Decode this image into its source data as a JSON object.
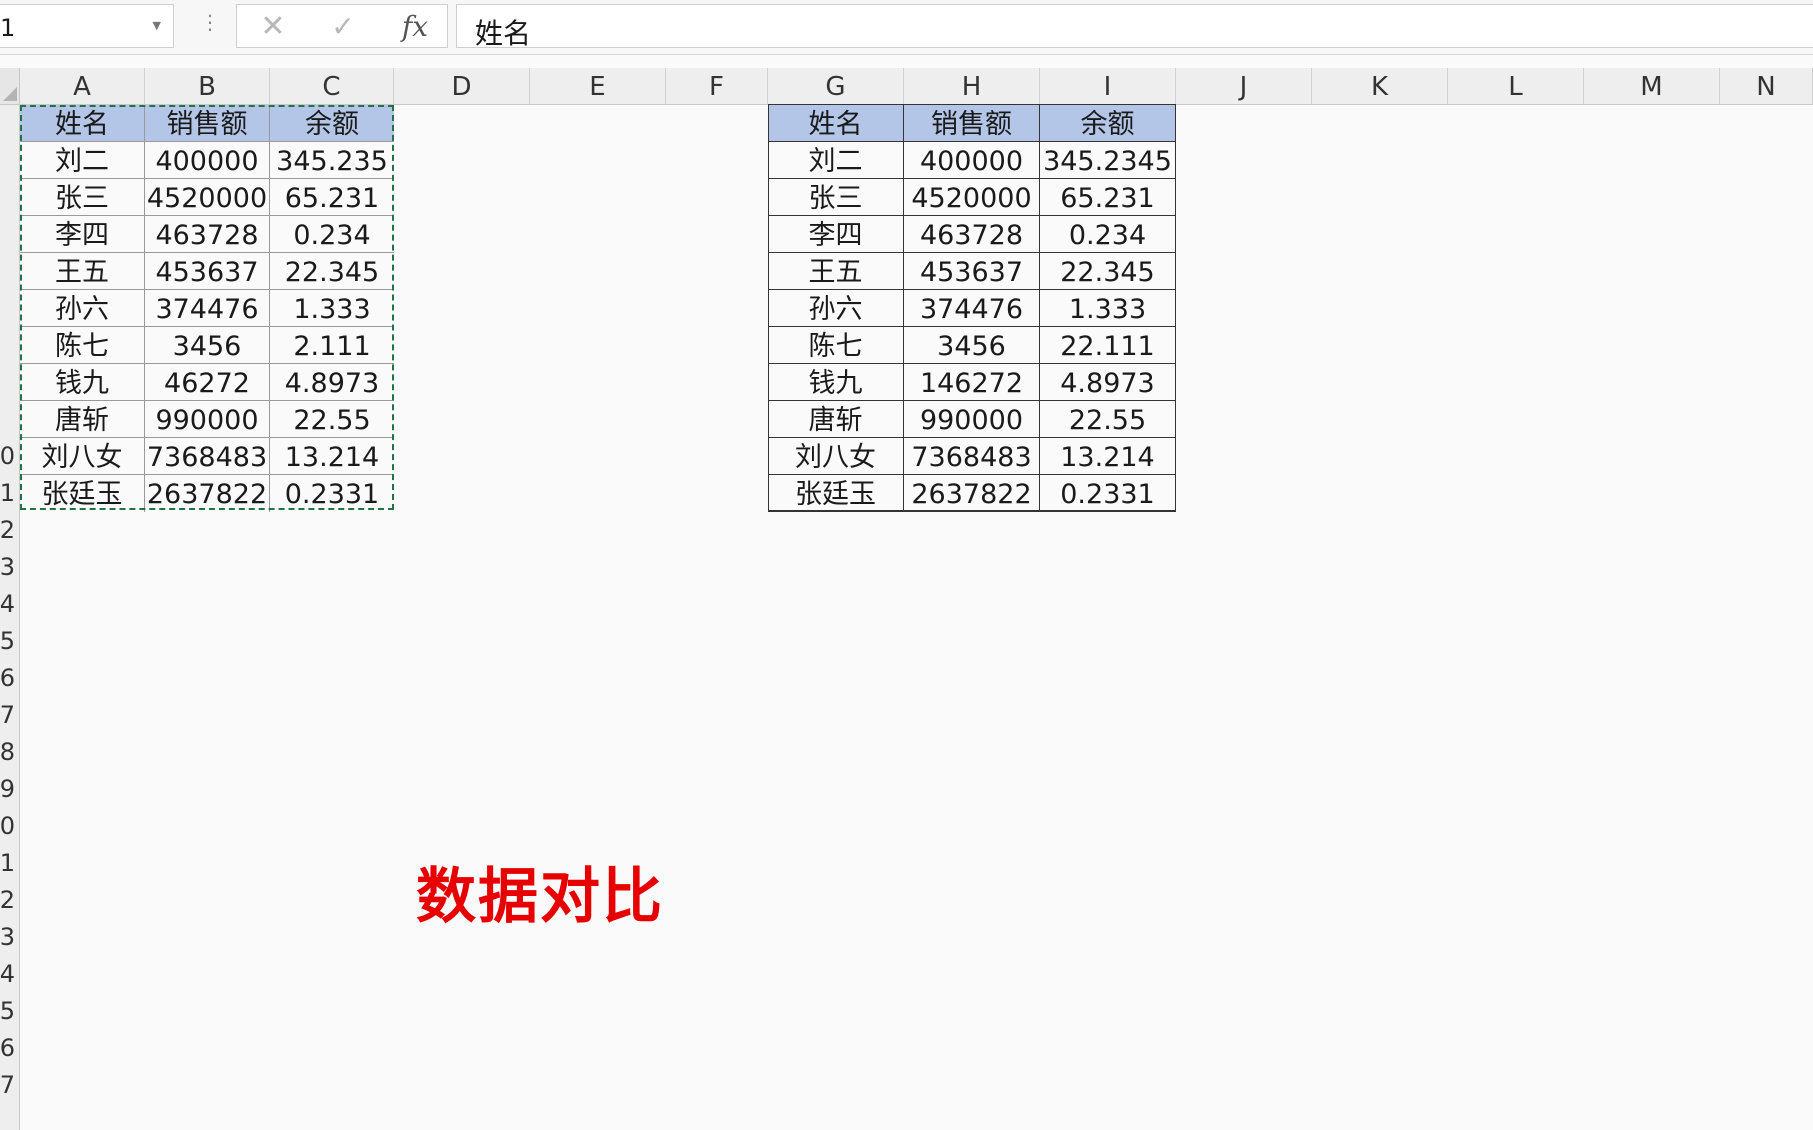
{
  "formula_bar": {
    "name_box_value": "1",
    "formula_value": "姓名",
    "icons": [
      "cancel-icon",
      "enter-icon",
      "fx-icon"
    ]
  },
  "grid": {
    "columns": [
      "A",
      "B",
      "C",
      "D",
      "E",
      "F",
      "G",
      "H",
      "I",
      "J",
      "K",
      "L",
      "M",
      "N"
    ],
    "row_labels": [
      "",
      "",
      "",
      "",
      "",
      "",
      "",
      "",
      "",
      "0",
      "1",
      "2",
      "3",
      "4",
      "5",
      "6",
      "7",
      "8",
      "9",
      "0",
      "1",
      "2",
      "3",
      "4",
      "5",
      "6",
      "7"
    ]
  },
  "table_left": {
    "headers": [
      "姓名",
      "销售额",
      "余额"
    ],
    "rows": [
      [
        "刘二",
        "400000",
        "345.235"
      ],
      [
        "张三",
        "4520000",
        "65.231"
      ],
      [
        "李四",
        "463728",
        "0.234"
      ],
      [
        "王五",
        "453637",
        "22.345"
      ],
      [
        "孙六",
        "374476",
        "1.333"
      ],
      [
        "陈七",
        "3456",
        "2.111"
      ],
      [
        "钱九",
        "46272",
        "4.8973"
      ],
      [
        "唐斩",
        "990000",
        "22.55"
      ],
      [
        "刘八女",
        "7368483",
        "13.214"
      ],
      [
        "张廷玉",
        "2637822",
        "0.2331"
      ]
    ]
  },
  "table_right": {
    "headers": [
      "姓名",
      "销售额",
      "余额"
    ],
    "rows": [
      [
        "刘二",
        "400000",
        "345.2345"
      ],
      [
        "张三",
        "4520000",
        "65.231"
      ],
      [
        "李四",
        "463728",
        "0.234"
      ],
      [
        "王五",
        "453637",
        "22.345"
      ],
      [
        "孙六",
        "374476",
        "1.333"
      ],
      [
        "陈七",
        "3456",
        "22.111"
      ],
      [
        "钱九",
        "146272",
        "4.8973"
      ],
      [
        "唐斩",
        "990000",
        "22.55"
      ],
      [
        "刘八女",
        "7368483",
        "13.214"
      ],
      [
        "张廷玉",
        "2637822",
        "0.2331"
      ]
    ]
  },
  "caption": "数据对比",
  "colors": {
    "header_fill": "#b4c6e7",
    "copy_marquee": "#217346",
    "caption": "#e60000"
  }
}
